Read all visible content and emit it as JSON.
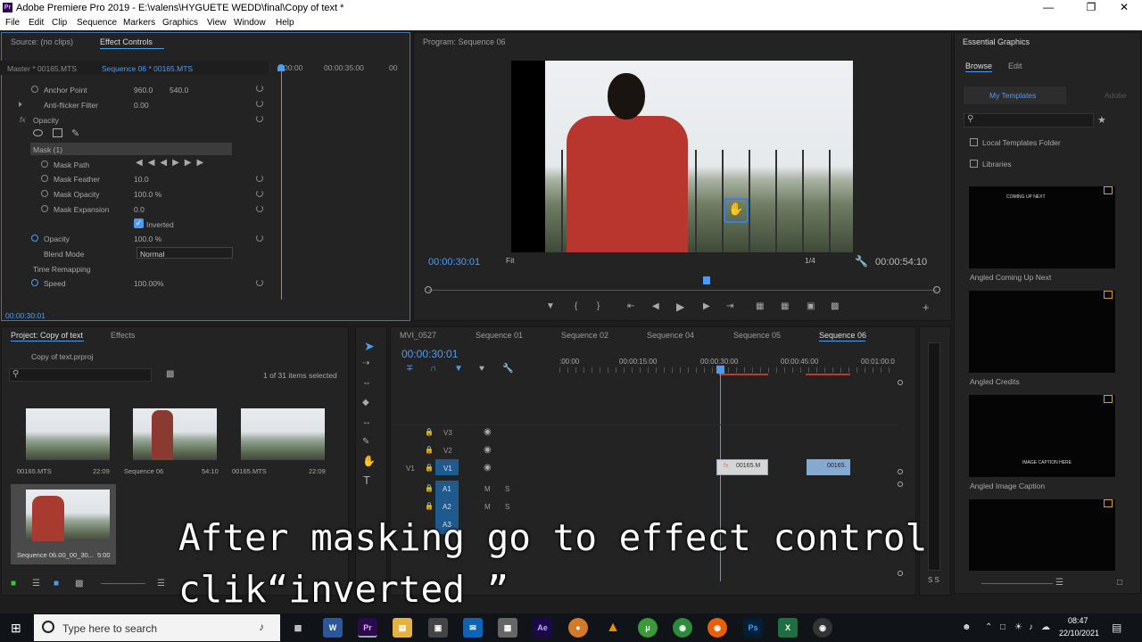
{
  "app": {
    "title": "Adobe Premiere Pro 2019 - E:\\valens\\HYGUETE WEDD\\final\\Copy of text *",
    "icon": "Pr"
  },
  "menu": [
    "File",
    "Edit",
    "Clip",
    "Sequence",
    "Markers",
    "Graphics",
    "View",
    "Window",
    "Help"
  ],
  "source_panel": {
    "tab_source": "Source: (no clips)",
    "tab_effect": "Effect Controls",
    "master": "Master * 00165.MTS",
    "sequence": "Sequence 06 * 00165.MTS",
    "tc_start": "00:00",
    "tc_mid": "00:00:35:00",
    "tc_end": "00",
    "footer_tc": "00:00:30:01"
  },
  "effects": {
    "anchor_label": "Anchor Point",
    "anchor_x": "960.0",
    "anchor_y": "540.0",
    "flicker_label": "Anti-flicker Filter",
    "flicker_val": "0.00",
    "opacity_label": "Opacity",
    "fx": "fx",
    "mask_label": "Mask (1)",
    "mask_path": "Mask Path",
    "mask_feather": "Mask Feather",
    "mask_feather_val": "10.0",
    "mask_opacity": "Mask Opacity",
    "mask_opacity_val": "100.0 %",
    "mask_expansion": "Mask Expansion",
    "mask_expansion_val": "0.0",
    "inverted": "Inverted",
    "opacity2": "Opacity",
    "opacity2_val": "100.0 %",
    "blend": "Blend Mode",
    "blend_val": "Normal",
    "time_remap": "Time Remapping",
    "speed": "Speed",
    "speed_val": "100.00%"
  },
  "program": {
    "title": "Program: Sequence 06",
    "tc": "00:00:30:01",
    "fit": "Fit",
    "quality": "1/4",
    "duration": "00:00:54:10"
  },
  "essential": {
    "title": "Essential Graphics",
    "browse": "Browse",
    "edit": "Edit",
    "my_templates": "My Templates",
    "adobe": "Adobe",
    "local": "Local Templates Folder",
    "libraries": "Libraries",
    "templates": [
      {
        "name": "Angled Coming Up Next",
        "text": "COMING UP NEXT"
      },
      {
        "name": "Angled Credits",
        "text": ""
      },
      {
        "name": "Angled Image Caption",
        "text": "IMAGE CAPTION HERE"
      }
    ]
  },
  "project": {
    "tab": "Project: Copy of text",
    "effects_tab": "Effects",
    "file": "Copy of text.prproj",
    "count": "1 of 31 items selected",
    "items": [
      {
        "name": "00165.MTS",
        "dur": "22:09"
      },
      {
        "name": "Sequence 06",
        "dur": "54:10"
      },
      {
        "name": "00165.MTS",
        "dur": "22:09"
      },
      {
        "name": "Sequence 06.00_00_30...",
        "dur": "5:00"
      }
    ]
  },
  "timeline": {
    "tabs": [
      "MVI_0527",
      "Sequence 01",
      "Sequence 02",
      "Sequence 04",
      "Sequence 05",
      "Sequence 06"
    ],
    "tc": "00:00:30:01",
    "ruler": [
      ":00:00",
      "00:00:15:00",
      "00:00:30:00",
      "00:00:45:00",
      "00:01:00:0"
    ],
    "tracks": [
      "V3",
      "V2",
      "V1",
      "A1",
      "A2",
      "A3"
    ],
    "clip1": "00165.M",
    "clip2": "00165.",
    "fx": "fx",
    "m": "M",
    "s": "S"
  },
  "caption": "After masking go to effect control\nclik“inverted ”",
  "taskbar": {
    "search": "Type here to search",
    "time": "08:47",
    "date": "22/10/2021"
  }
}
